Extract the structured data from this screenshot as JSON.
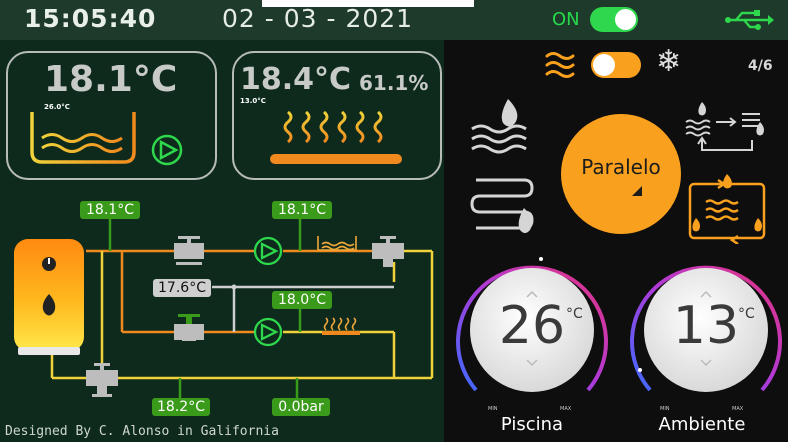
{
  "header": {
    "time": "15:05:40",
    "date": "02 - 03 - 2021",
    "power_label": "ON",
    "power_on": true,
    "usb_icon": "usb-icon"
  },
  "cards": {
    "pool": {
      "temp": "18.1°C",
      "setpoint": "26.0°C",
      "icons": [
        "pool-water-icon",
        "pump-icon"
      ]
    },
    "ambient": {
      "temp": "18.4°C",
      "humidity": "61.1%",
      "setpoint": "13.0°C",
      "icons": [
        "floor-heating-icon"
      ]
    }
  },
  "diagram": {
    "tags": {
      "t_top_left": "18.1°C",
      "t_top_mid": "18.1°C",
      "t_bypass": "17.6°C",
      "t_mid": "18.0°C",
      "t_bottom": "18.2°C",
      "pressure": "0.0bar"
    },
    "icons": [
      "boiler-icon",
      "thermostat-icon",
      "flame-icon",
      "valve-icon",
      "pump-icon",
      "three-way-valve-icon"
    ]
  },
  "modes": {
    "page": "4/6",
    "heat_mode_on": true,
    "icons": [
      "waves-icon",
      "snowflake-icon",
      "heat-pump-icon",
      "floor-coil-icon",
      "series-icon",
      "parallel-icon"
    ],
    "selected_mode": "Paralelo"
  },
  "dials": [
    {
      "value": "26",
      "unit": "°C",
      "min": "MIN",
      "max": "MAX",
      "name": "Piscina"
    },
    {
      "value": "13",
      "unit": "°C",
      "min": "MIN",
      "max": "MAX",
      "name": "Ambiente"
    }
  ],
  "footer": "Designed By C. Alonso in Galifornia",
  "colors": {
    "topbar": "#1d3a2a",
    "panel_left": "#0d2a1d",
    "accent_orange": "#f9a11e",
    "accent_green": "#2ed74c",
    "tag_green": "#3a9a1a",
    "pipe_yellow": "#f0d23a",
    "pipe_orange": "#f08a1e"
  }
}
